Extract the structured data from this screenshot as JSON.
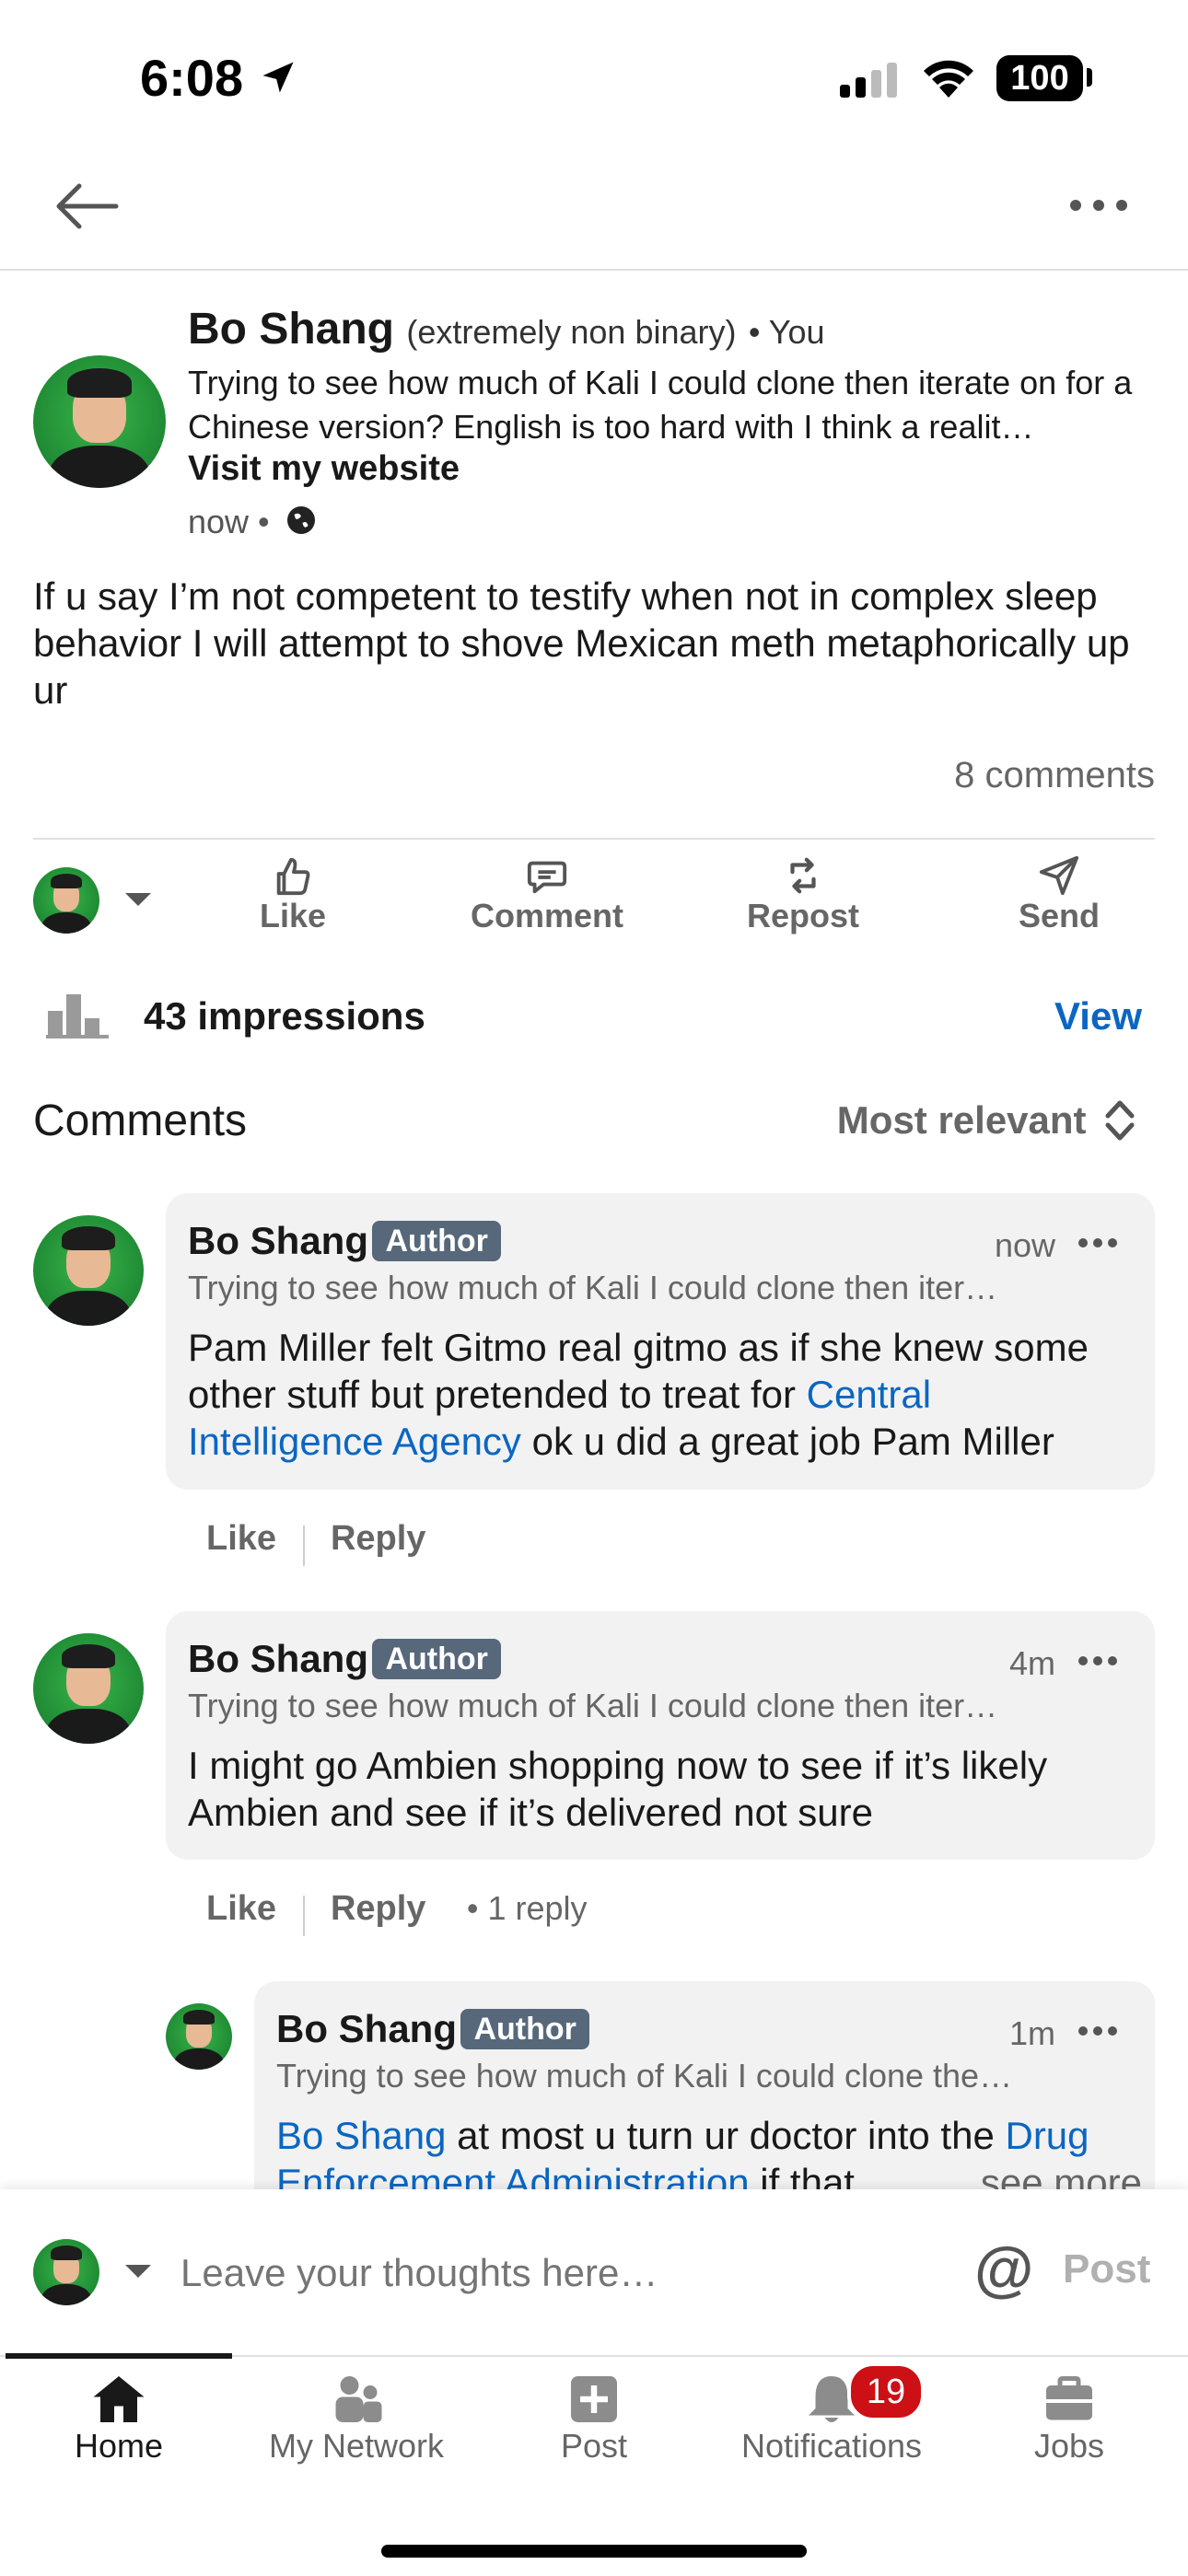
{
  "status_bar": {
    "time": "6:08",
    "battery": "100"
  },
  "header": {
    "back_icon": "arrow-left-icon",
    "more_icon": "more-icon"
  },
  "post": {
    "author_name": "Bo Shang",
    "pronouns": "(extremely non binary)",
    "relation": "• You",
    "headline": "Trying to see how much of Kali I could clone then iterate on for a Chinese version? English is too hard with I think a realit…",
    "website_link": "Visit my website",
    "time": "now •",
    "body": "If u say I’m not competent to testify when not in complex sleep behavior I will attempt to shove Mexican meth metaphorically up ur",
    "comments_count": "8 comments"
  },
  "actions": {
    "like": "Like",
    "comment": "Comment",
    "repost": "Repost",
    "send": "Send"
  },
  "impressions": {
    "label": "43 impressions",
    "view": "View"
  },
  "comments_header": {
    "title": "Comments",
    "sort": "Most relevant"
  },
  "comments": [
    {
      "name": "Bo Shang",
      "badge": "Author",
      "time": "now",
      "headline": "Trying to see how much of Kali I could clone then iter…",
      "text_a": "Pam Miller felt Gitmo real gitmo as if she knew some other stuff but pretended to treat for ",
      "link": "Central Intelligence Agency",
      "text_b": " ok u did a great job Pam Miller",
      "like": "Like",
      "reply": "Reply"
    },
    {
      "name": "Bo Shang",
      "badge": "Author",
      "time": "4m",
      "headline": "Trying to see how much of Kali I could clone then iter…",
      "text": "I might go Ambien shopping now to see if it’s likely Ambien and see if it’s delivered not sure",
      "like": "Like",
      "reply": "Reply",
      "replies": "•  1 reply"
    }
  ],
  "reply": {
    "name": "Bo Shang",
    "badge": "Author",
    "time": "1m",
    "headline": "Trying to see how much of Kali I could clone the…",
    "mention": "Bo Shang",
    "text_a": " at most u turn ur doctor into the ",
    "link": "Drug Enforcement Administration",
    "text_b": " if that",
    "see_more": "…see more"
  },
  "composer": {
    "placeholder": "Leave your thoughts here…",
    "at": "@",
    "post": "Post"
  },
  "bottom_nav": {
    "items": [
      {
        "label": "Home",
        "icon": "home-icon"
      },
      {
        "label": "My Network",
        "icon": "network-icon"
      },
      {
        "label": "Post",
        "icon": "plus-square-icon"
      },
      {
        "label": "Notifications",
        "icon": "bell-icon",
        "badge": "19"
      },
      {
        "label": "Jobs",
        "icon": "briefcase-icon"
      }
    ]
  },
  "colors": {
    "accent": "#0a66c2",
    "badge_red": "#cc1016",
    "author_badge": "#56687a"
  }
}
